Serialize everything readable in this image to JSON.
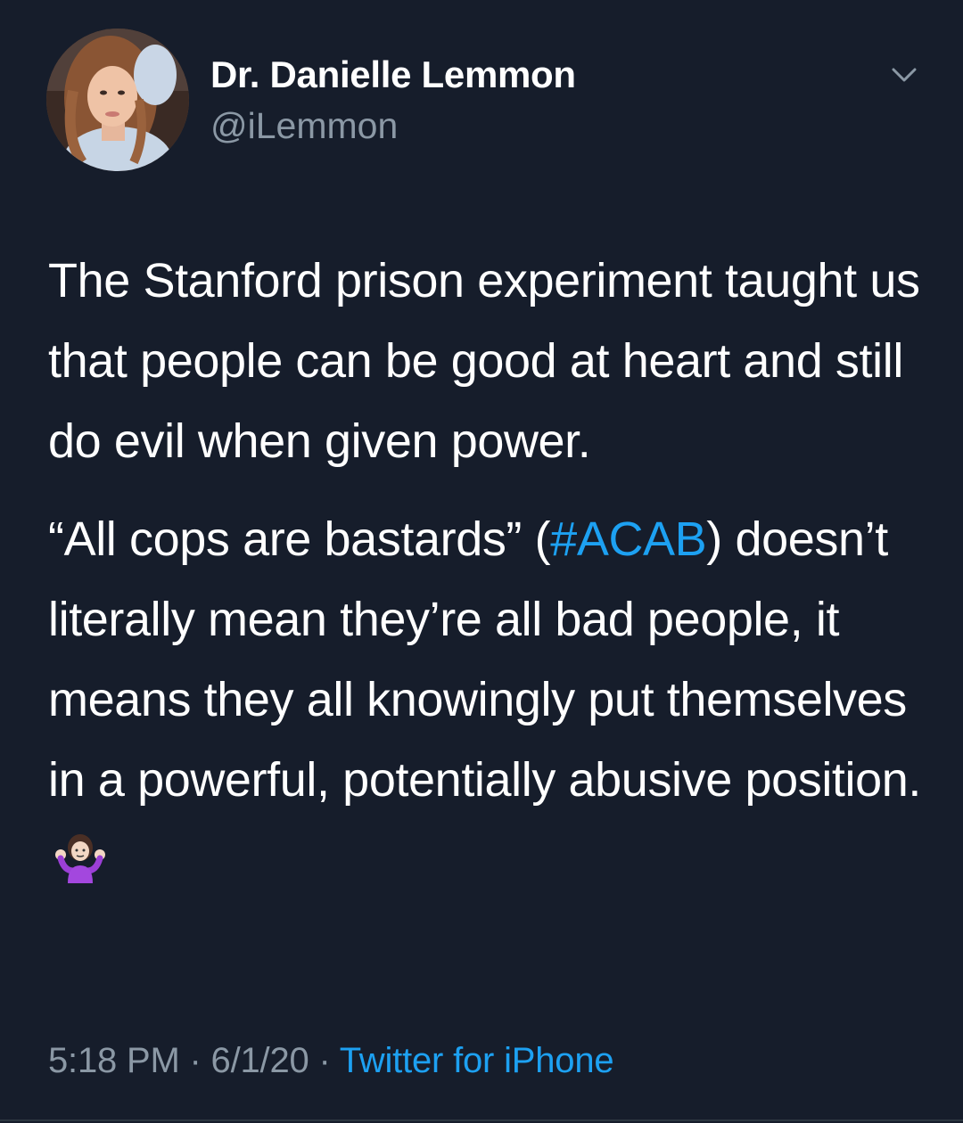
{
  "author": {
    "display_name": "Dr. Danielle Lemmon",
    "handle": "@iLemmon"
  },
  "tweet": {
    "paragraph_1": "The Stanford prison experiment taught us that people can be good at heart and still do evil when given power.",
    "paragraph_2_before": "“All cops are bastards” (",
    "hashtag": "#ACAB",
    "paragraph_2_after": ") doesn’t literally mean they’re all bad people, it means they all knowingly put themselves in a powerful, potentially abusive position.",
    "emoji": "person-shrugging-emoji"
  },
  "meta": {
    "time": "5:18 PM",
    "separator_1": " · ",
    "date": "6/1/20",
    "separator_2": " · ",
    "source": "Twitter for iPhone"
  },
  "colors": {
    "background": "#161d2b",
    "text": "#ffffff",
    "secondary": "#8b98a5",
    "link": "#1da1f2"
  },
  "icons": {
    "menu": "chevron-down-icon"
  }
}
